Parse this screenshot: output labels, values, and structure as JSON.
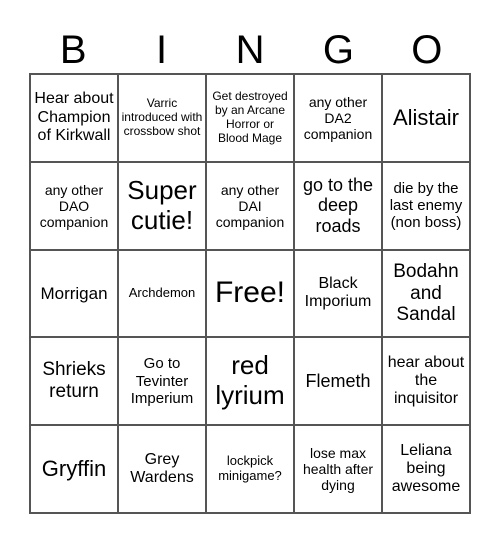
{
  "header": [
    "B",
    "I",
    "N",
    "G",
    "O"
  ],
  "cells": [
    [
      "Hear about Champion of Kirkwall",
      "Varric introduced with crossbow shot",
      "Get destroyed by an Arcane Horror or Blood Mage",
      "any other DA2 companion",
      "Alistair"
    ],
    [
      "any other DAO companion",
      "Super cutie!",
      "any other DAI companion",
      "go to the deep roads",
      "die by the last enemy (non boss)"
    ],
    [
      "Morrigan",
      "Archdemon",
      "Free!",
      "Black Imporium",
      "Bodahn and Sandal"
    ],
    [
      "Shrieks return",
      "Go to Tevinter Imperium",
      "red lyrium",
      "Flemeth",
      "hear about the inquisitor"
    ],
    [
      "Gryffin",
      "Grey Wardens",
      "lockpick minigame?",
      "lose max health after dying",
      "Leliana being awesome"
    ]
  ]
}
